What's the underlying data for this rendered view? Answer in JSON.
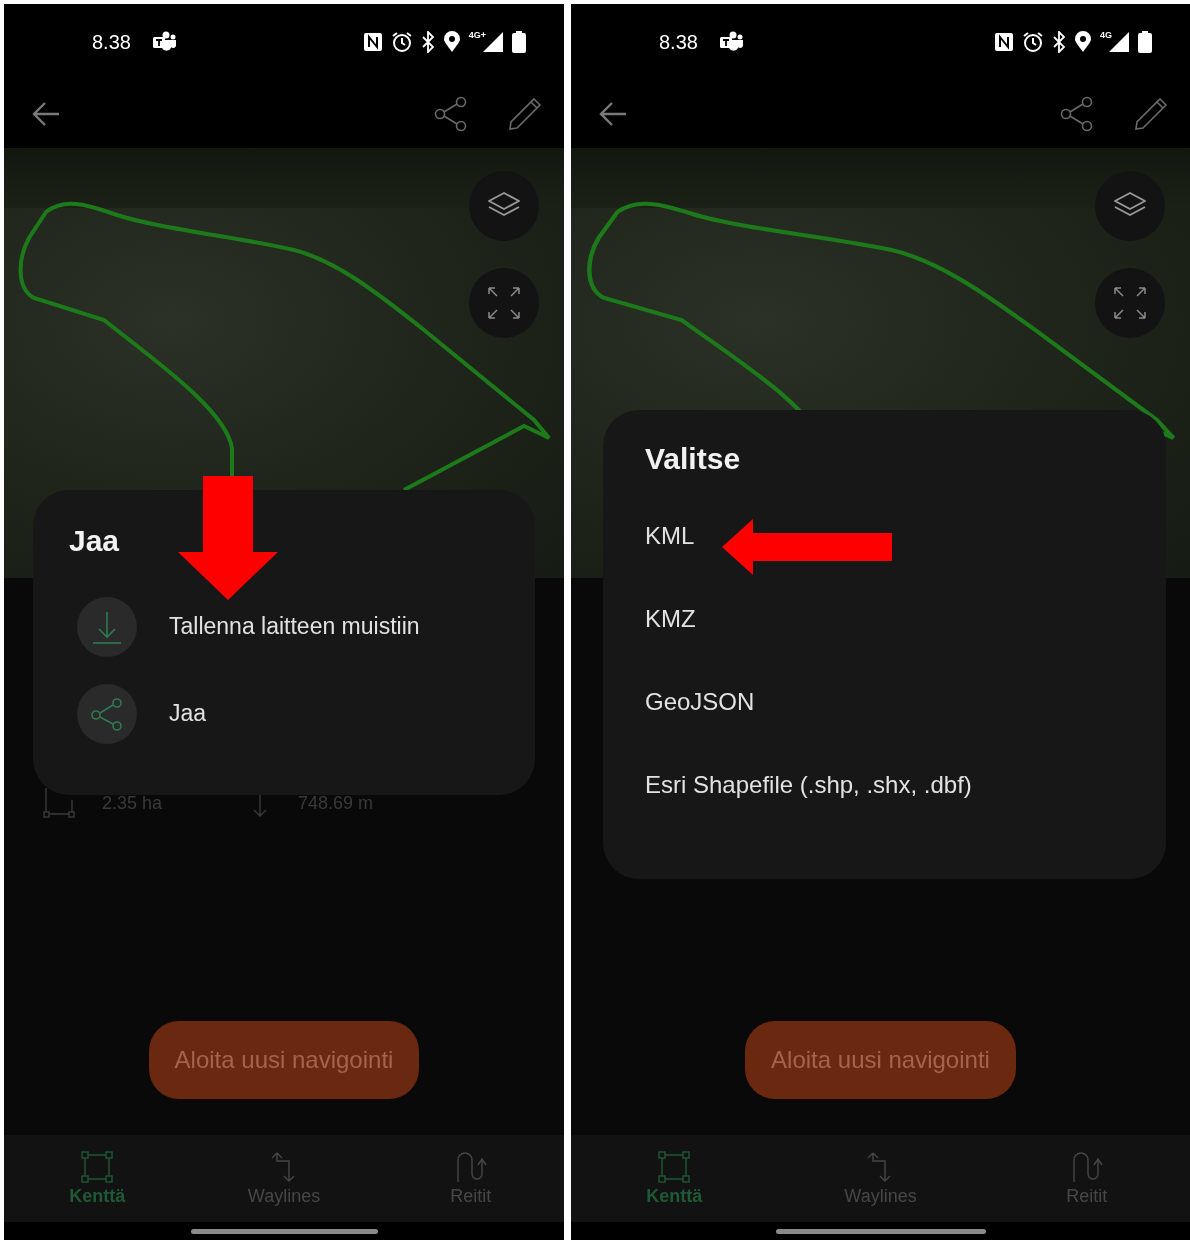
{
  "phones": [
    {
      "status_bar": {
        "time": "8.38",
        "network": "4G+"
      },
      "stats": [
        {
          "kind": "area",
          "value": "2.35 ha"
        },
        {
          "kind": "length",
          "value": "748.69 m"
        }
      ],
      "primary_button": "Aloita uusi navigointi",
      "bottom_nav": [
        {
          "kind": "field",
          "label": "Kenttä",
          "selected": true
        },
        {
          "kind": "waylines",
          "label": "Waylines",
          "selected": false
        },
        {
          "kind": "routes",
          "label": "Reitit",
          "selected": false
        }
      ],
      "dialog": {
        "title": "Jaa",
        "items": [
          {
            "kind": "download",
            "label": "Tallenna laitteen muistiin"
          },
          {
            "kind": "share",
            "label": "Jaa"
          }
        ]
      },
      "annotations": [
        {
          "kind": "down"
        }
      ]
    },
    {
      "status_bar": {
        "time": "8.38",
        "network": "4G"
      },
      "primary_button": "Aloita uusi navigointi",
      "bottom_nav": [
        {
          "kind": "field",
          "label": "Kenttä",
          "selected": true
        },
        {
          "kind": "waylines",
          "label": "Waylines",
          "selected": false
        },
        {
          "kind": "routes",
          "label": "Reitit",
          "selected": false
        }
      ],
      "dialog": {
        "title": "Valitse",
        "items": [
          {
            "kind": "format",
            "label": "KML"
          },
          {
            "kind": "format",
            "label": "KMZ"
          },
          {
            "kind": "format",
            "label": "GeoJSON"
          },
          {
            "kind": "format",
            "label": "Esri Shapefile (.shp, .shx, .dbf)"
          }
        ]
      },
      "annotations": [
        {
          "kind": "left"
        }
      ]
    }
  ]
}
